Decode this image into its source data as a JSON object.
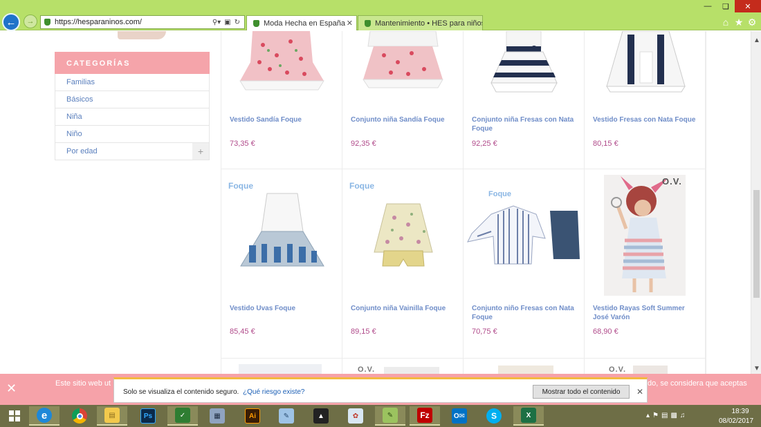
{
  "browser": {
    "url": "https://hesparaninos.com/",
    "tabs": [
      {
        "label": "Moda Hecha en España par...",
        "active": true
      },
      {
        "label": "Mantenimiento • HES para niños",
        "active": false
      }
    ]
  },
  "sidebar": {
    "title": "CATEGORÍAS",
    "items": [
      {
        "label": "Familias"
      },
      {
        "label": "Básicos"
      },
      {
        "label": "Niña"
      },
      {
        "label": "Niño"
      },
      {
        "label": "Por edad",
        "expandable": true
      }
    ]
  },
  "products": [
    {
      "name": "Vestido Sandía Foque",
      "price": "73,35 €"
    },
    {
      "name": "Conjunto niña Sandía Foque",
      "price": "92,35 €"
    },
    {
      "name": "Conjunto niña Fresas con Nata Foque",
      "price": "92,25 €"
    },
    {
      "name": "Vestido Fresas con Nata Foque",
      "price": "80,15 €"
    },
    {
      "name": "Vestido Uvas Foque",
      "price": "85,45 €",
      "brand": "Foque"
    },
    {
      "name": "Conjunto niña Vainilla Foque",
      "price": "89,15 €",
      "brand": "Foque"
    },
    {
      "name": "Conjunto niño Fresas con Nata Foque",
      "price": "70,75 €",
      "brand": "Foque"
    },
    {
      "name": "Vestido Rayas Soft Summer José Varón",
      "price": "68,90 €",
      "brand": "O.V."
    }
  ],
  "cookie_bar": {
    "text_left": "Este sitio web ut",
    "text_right": "do, se considera que aceptas"
  },
  "notification": {
    "message": "Solo se visualiza el contenido seguro.",
    "link": "¿Qué riesgo existe?",
    "button": "Mostrar todo el contenido"
  },
  "taskbar": {
    "apps": [
      "internet-explorer",
      "chrome",
      "file-explorer",
      "photoshop",
      "corel",
      "calculator",
      "illustrator",
      "notepad",
      "inkscape",
      "paint",
      "notepad-plus-plus",
      "filezilla",
      "outlook",
      "skype",
      "excel"
    ],
    "clock_time": "18:39",
    "clock_date": "08/02/2017"
  },
  "colors": {
    "chrome_green": "#b7e069",
    "category_pink": "#f5a4aa",
    "link_blue": "#6f8dc8",
    "price_magenta": "#b04a8a",
    "taskbar": "#6e6e46"
  }
}
